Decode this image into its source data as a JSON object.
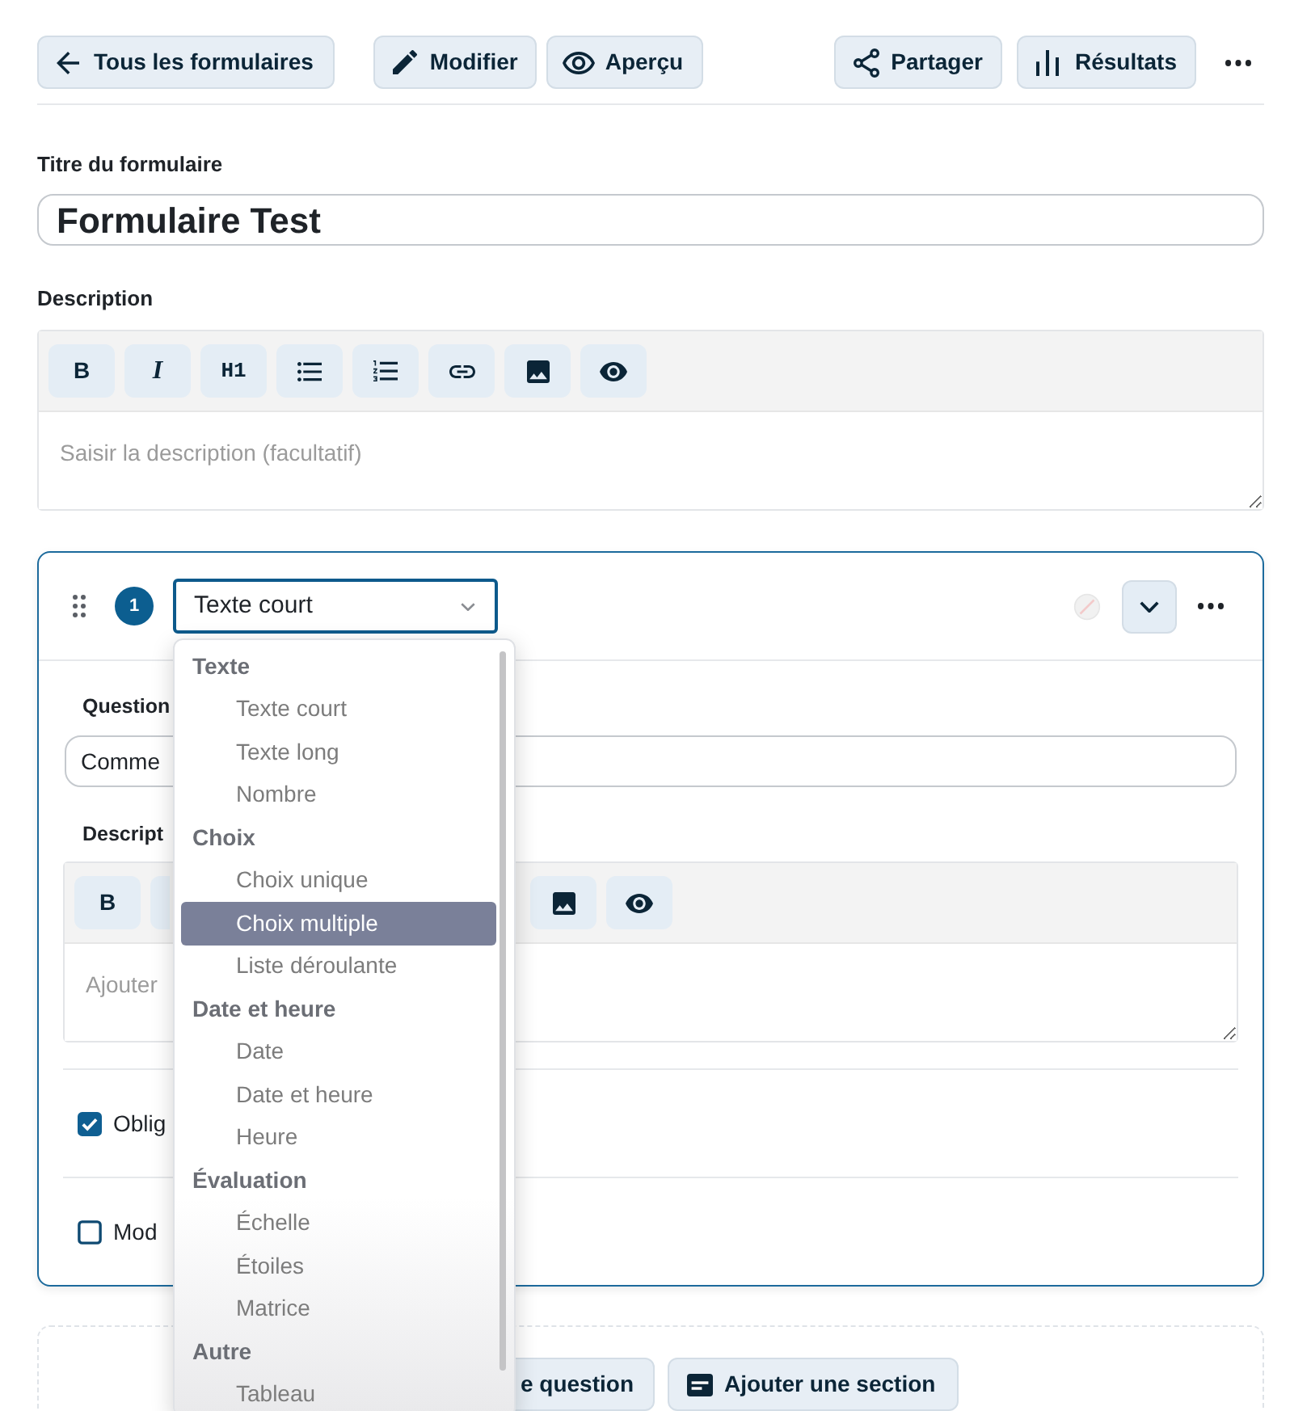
{
  "top_bar": {
    "back_button": "Tous les formulaires",
    "edit_button": "Modifier",
    "preview_button": "Aperçu",
    "share_button": "Partager",
    "results_button": "Résultats"
  },
  "form": {
    "title_label": "Titre du formulaire",
    "title_value": "Formulaire Test",
    "description_label": "Description",
    "description_toolbar": {
      "bold": "B",
      "italic": "I",
      "heading": "H1"
    },
    "description_placeholder": "Saisir la description (facultatif)"
  },
  "question": {
    "number": "1",
    "type_select": {
      "value": "Texte court",
      "expanded": true,
      "groups": [
        {
          "label": "Texte",
          "items": [
            {
              "label": "Texte court",
              "selected": false
            },
            {
              "label": "Texte long",
              "selected": false
            },
            {
              "label": "Nombre",
              "selected": false
            }
          ]
        },
        {
          "label": "Choix",
          "items": [
            {
              "label": "Choix unique",
              "selected": false
            },
            {
              "label": "Choix multiple",
              "selected": true
            },
            {
              "label": "Liste déroulante",
              "selected": false
            }
          ]
        },
        {
          "label": "Date et heure",
          "items": [
            {
              "label": "Date",
              "selected": false
            },
            {
              "label": "Date et heure",
              "selected": false
            },
            {
              "label": "Heure",
              "selected": false
            }
          ]
        },
        {
          "label": "Évaluation",
          "items": [
            {
              "label": "Échelle",
              "selected": false
            },
            {
              "label": "Étoiles",
              "selected": false
            },
            {
              "label": "Matrice",
              "selected": false
            }
          ]
        },
        {
          "label": "Autre",
          "items": [
            {
              "label": "Tableau",
              "selected": false
            }
          ]
        }
      ]
    },
    "question_label": "Question",
    "question_value": "Comme",
    "description_label": "Descript",
    "description_toolbar": {
      "bold": "B"
    },
    "description_placeholder": "Ajouter",
    "options": [
      {
        "label": "Oblig",
        "checked": true
      },
      {
        "label": "Mod",
        "checked": false
      }
    ]
  },
  "add_area": {
    "question_button": "e question",
    "section_button": "Ajouter une section"
  }
}
